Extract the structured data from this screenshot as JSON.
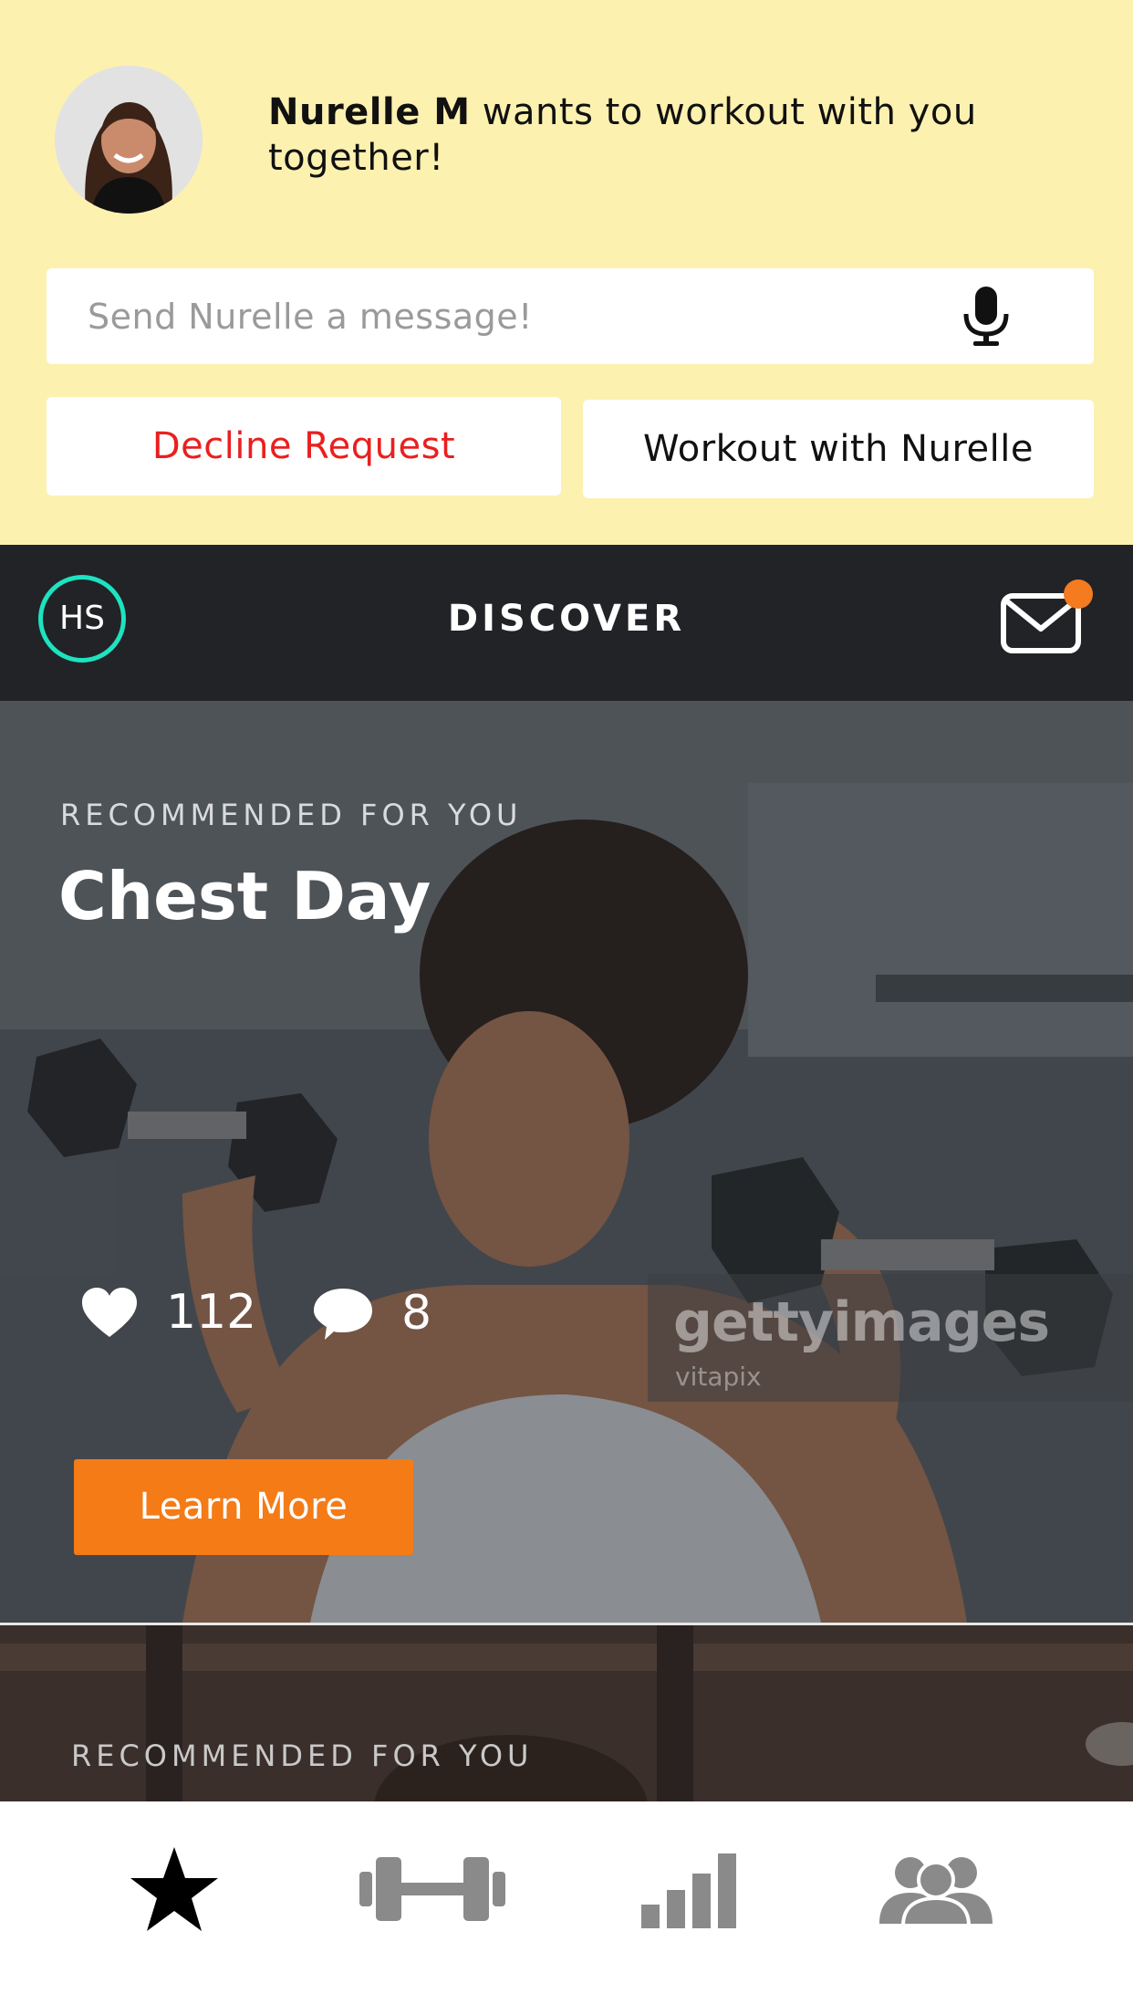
{
  "request": {
    "name": "Nurelle M",
    "message": " wants to workout with you together!",
    "input_placeholder": "Send Nurelle a message!",
    "decline_label": "Decline Request",
    "accept_label": "Workout with Nurelle"
  },
  "header": {
    "avatar_initials": "HS",
    "title": "DISCOVER"
  },
  "cards": [
    {
      "eyebrow": "RECOMMENDED FOR YOU",
      "title": "Chest Day",
      "likes": "112",
      "comments": "8",
      "cta": "Learn More",
      "watermark": "gettyimages",
      "watermark_sub": "vitapix"
    },
    {
      "eyebrow": "RECOMMENDED FOR YOU"
    }
  ],
  "tabs": [
    {
      "icon": "star-icon",
      "active": true
    },
    {
      "icon": "dumbbell-icon",
      "active": false
    },
    {
      "icon": "stats-bars-icon",
      "active": false
    },
    {
      "icon": "group-icon",
      "active": false
    }
  ],
  "colors": {
    "banner": "#fdf1b0",
    "accent": "#f47b16",
    "decline": "#ea1f1f",
    "ring": "#1de3c0",
    "header": "#222326"
  }
}
